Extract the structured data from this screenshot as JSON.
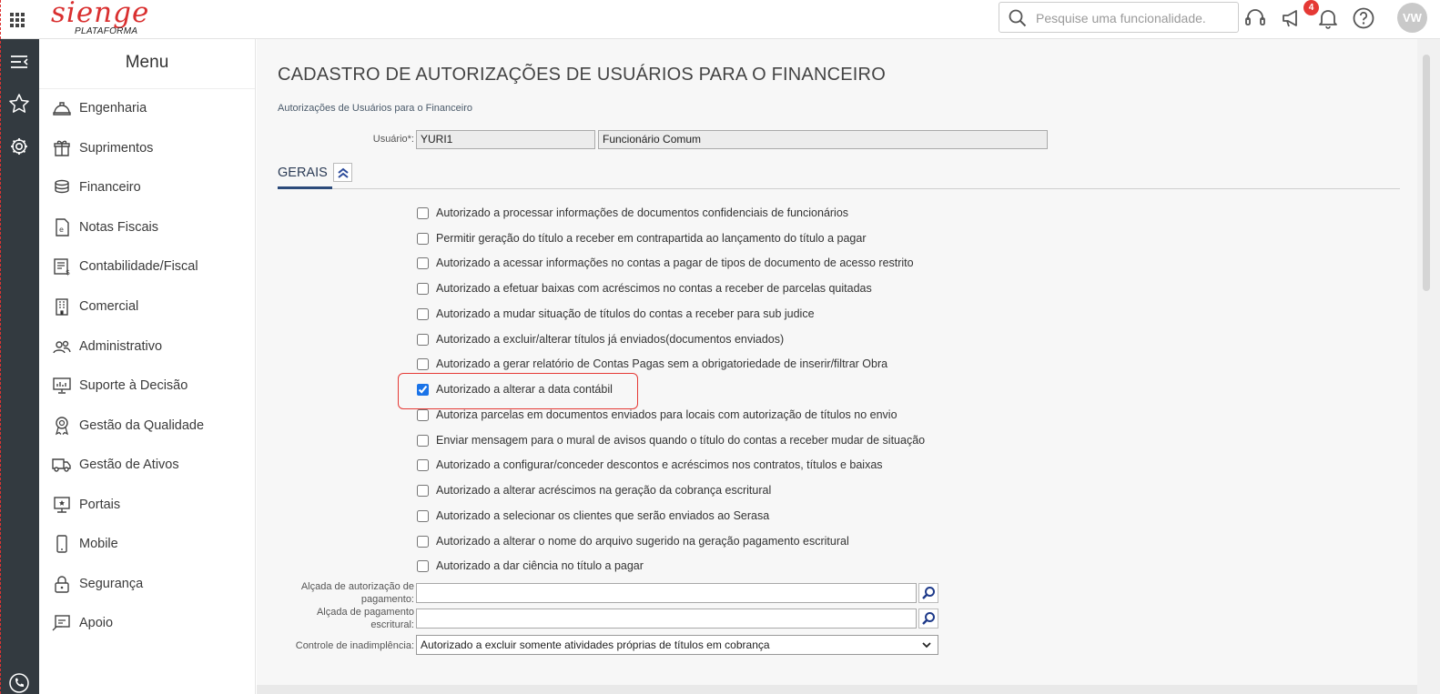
{
  "header": {
    "logo_text": "sienge",
    "logo_sub": "PLATAFORMA",
    "search_placeholder": "Pesquise uma funcionalidade.",
    "notification_count": "4",
    "avatar_initials": "VW"
  },
  "menu": {
    "title": "Menu",
    "items": [
      {
        "label": "Engenharia",
        "icon": "helmet-icon"
      },
      {
        "label": "Suprimentos",
        "icon": "box-icon"
      },
      {
        "label": "Financeiro",
        "icon": "coins-icon"
      },
      {
        "label": "Notas Fiscais",
        "icon": "document-e-icon"
      },
      {
        "label": "Contabilidade/Fiscal",
        "icon": "ledger-icon"
      },
      {
        "label": "Comercial",
        "icon": "building-icon"
      },
      {
        "label": "Administrativo",
        "icon": "people-icon"
      },
      {
        "label": "Suporte à Decisão",
        "icon": "monitor-chart-icon"
      },
      {
        "label": "Gestão da Qualidade",
        "icon": "award-icon"
      },
      {
        "label": "Gestão de Ativos",
        "icon": "truck-icon"
      },
      {
        "label": "Portais",
        "icon": "portal-icon"
      },
      {
        "label": "Mobile",
        "icon": "phone-icon"
      },
      {
        "label": "Segurança",
        "icon": "lock-icon"
      },
      {
        "label": "Apoio",
        "icon": "support-icon"
      }
    ]
  },
  "page": {
    "title": "CADASTRO DE AUTORIZAÇÕES DE USUÁRIOS PARA O FINANCEIRO",
    "subtitle": "Autorizações de Usuários para o Financeiro",
    "user_label": "Usuário*:",
    "user_code": "YURI1",
    "user_name": "Funcionário Comum",
    "tab_label": "GERAIS"
  },
  "permissions": [
    {
      "label": "Autorizado a processar informações de documentos confidenciais de funcionários",
      "checked": false
    },
    {
      "label": "Permitir geração do título a receber em contrapartida ao lançamento do título a pagar",
      "checked": false
    },
    {
      "label": "Autorizado a acessar informações no contas a pagar de tipos de documento de acesso restrito",
      "checked": false
    },
    {
      "label": "Autorizado a efetuar baixas com acréscimos no contas a receber de parcelas quitadas",
      "checked": false
    },
    {
      "label": "Autorizado a mudar situação de títulos do contas a receber para sub judice",
      "checked": false
    },
    {
      "label": "Autorizado a excluir/alterar títulos já enviados(documentos enviados)",
      "checked": false
    },
    {
      "label": "Autorizado a gerar relatório de Contas Pagas sem a obrigatoriedade de inserir/filtrar Obra",
      "checked": false
    },
    {
      "label": "Autorizado a alterar a data contábil",
      "checked": true
    },
    {
      "label": "Autoriza parcelas em documentos enviados para locais com autorização de títulos no envio",
      "checked": false
    },
    {
      "label": "Enviar mensagem para o mural de avisos quando o título do contas a receber mudar de situação",
      "checked": false
    },
    {
      "label": "Autorizado a configurar/conceder descontos e acréscimos nos contratos, títulos e baixas",
      "checked": false
    },
    {
      "label": "Autorizado a alterar acréscimos na geração da cobrança escritural",
      "checked": false
    },
    {
      "label": "Autorizado a selecionar os clientes que serão enviados ao Serasa",
      "checked": false
    },
    {
      "label": "Autorizado a alterar o nome do arquivo sugerido na geração pagamento escritural",
      "checked": false
    },
    {
      "label": "Autorizado a dar ciência no título a pagar",
      "checked": false
    }
  ],
  "form": {
    "alcada_pagamento_label_1": "Alçada de autorização de",
    "alcada_pagamento_label_2": "pagamento:",
    "alcada_pagamento_value": "",
    "alcada_escritural_label_1": "Alçada de pagamento",
    "alcada_escritural_label_2": "escritural:",
    "alcada_escritural_value": "",
    "inadimplencia_label": "Controle de inadimplência:",
    "inadimplencia_value": "Autorizado a excluir somente atividades próprias de títulos em cobrança"
  },
  "colors": {
    "brand_red": "#d92f2f",
    "rail_dark": "#333a40",
    "tab_accent": "#2b4a7a",
    "highlight": "#e53935"
  }
}
